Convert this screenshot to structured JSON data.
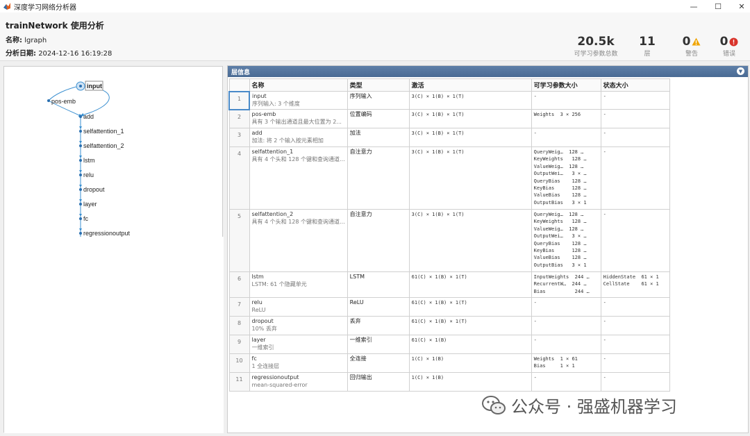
{
  "window": {
    "title": "深度学习网络分析器",
    "min": "—",
    "max": "☐",
    "close": "✕"
  },
  "header": {
    "title": "trainNetwork 使用分析",
    "name_label": "名称:",
    "name_value": "lgraph",
    "date_label": "分析日期:",
    "date_value": "2024-12-16 16:19:28"
  },
  "stats": [
    {
      "value": "20.5k",
      "label": "可学习参数总数"
    },
    {
      "value": "11",
      "label": "层"
    },
    {
      "value": "0",
      "label": "警告",
      "icon": "warning-icon",
      "color": "#f0a500"
    },
    {
      "value": "0",
      "label": "错误",
      "icon": "error-icon",
      "color": "#d9342b"
    }
  ],
  "graph": {
    "nodes": [
      "input",
      "pos-emb",
      "add",
      "selfattention_1",
      "selfattention_2",
      "lstm",
      "relu",
      "dropout",
      "layer",
      "fc",
      "regressionoutput"
    ]
  },
  "layer_panel": {
    "title": "层信息",
    "columns": [
      "名称",
      "类型",
      "激活",
      "可学习参数大小",
      "状态大小"
    ]
  },
  "layers": [
    {
      "idx": "1",
      "name": "input",
      "desc": "序列输入: 3 个维度",
      "type": "序列输入",
      "act": "3(C) × 1(B) × 1(T)",
      "params": [
        "-"
      ],
      "state": [
        "-"
      ]
    },
    {
      "idx": "2",
      "name": "pos-emb",
      "desc": "具有 3 个输出通道且最大位置为 2...",
      "type": "位置编码",
      "act": "3(C) × 1(B) × 1(T)",
      "params": [
        "Weights  3 × 256"
      ],
      "state": [
        "-"
      ]
    },
    {
      "idx": "3",
      "name": "add",
      "desc": "加法: 将 2 个输入按元素相加",
      "type": "加法",
      "act": "3(C) × 1(B) × 1(T)",
      "params": [
        "-"
      ],
      "state": [
        "-"
      ]
    },
    {
      "idx": "4",
      "name": "selfattention_1",
      "desc": "具有 4 个头和 128 个键和查询通道...",
      "type": "自注意力",
      "act": "3(C) × 1(B) × 1(T)",
      "params": [
        "QueryWeig…  128 …",
        "KeyWeights   128 …",
        "ValueWeig…  128 …",
        "OutputWei…   3 × …",
        "QueryBias    128 …",
        "KeyBias      128 …",
        "ValueBias    128 …",
        "OutputBias   3 × 1"
      ],
      "state": [
        "-"
      ]
    },
    {
      "idx": "5",
      "name": "selfattention_2",
      "desc": "具有 4 个头和 128 个键和查询通道...",
      "type": "自注意力",
      "act": "3(C) × 1(B) × 1(T)",
      "params": [
        "QueryWeig…  128 …",
        "KeyWeights   128 …",
        "ValueWeig…  128 …",
        "OutputWei…   3 × …",
        "QueryBias    128 …",
        "KeyBias      128 …",
        "ValueBias    128 …",
        "OutputBias   3 × 1"
      ],
      "state": [
        "-"
      ]
    },
    {
      "idx": "6",
      "name": "lstm",
      "desc": "LSTM: 61 个隐藏单元",
      "type": "LSTM",
      "act": "61(C) × 1(B) × 1(T)",
      "params": [
        "InputWeights  244 …",
        "RecurrentW…  244 …",
        "Bias          244 …"
      ],
      "state": [
        "HiddenState  61 × 1",
        "CellState    61 × 1"
      ]
    },
    {
      "idx": "7",
      "name": "relu",
      "desc": "ReLU",
      "type": "ReLU",
      "act": "61(C) × 1(B) × 1(T)",
      "params": [
        "-"
      ],
      "state": [
        "-"
      ]
    },
    {
      "idx": "8",
      "name": "dropout",
      "desc": "10% 丢弃",
      "type": "丢弃",
      "act": "61(C) × 1(B) × 1(T)",
      "params": [
        "-"
      ],
      "state": [
        "-"
      ]
    },
    {
      "idx": "9",
      "name": "layer",
      "desc": "一维索引",
      "type": "一维索引",
      "act": "61(C) × 1(B)",
      "params": [
        "-"
      ],
      "state": [
        "-"
      ]
    },
    {
      "idx": "10",
      "name": "fc",
      "desc": "1 全连接层",
      "type": "全连接",
      "act": "1(C) × 1(B)",
      "params": [
        "Weights  1 × 61",
        "Bias     1 × 1"
      ],
      "state": [
        "-"
      ]
    },
    {
      "idx": "11",
      "name": "regressionoutput",
      "desc": "mean-squared-error",
      "type": "回归输出",
      "act": "1(C) × 1(B)",
      "params": [
        "-"
      ],
      "state": [
        "-"
      ]
    }
  ],
  "watermark": "公众号 · 强盛机器学习"
}
